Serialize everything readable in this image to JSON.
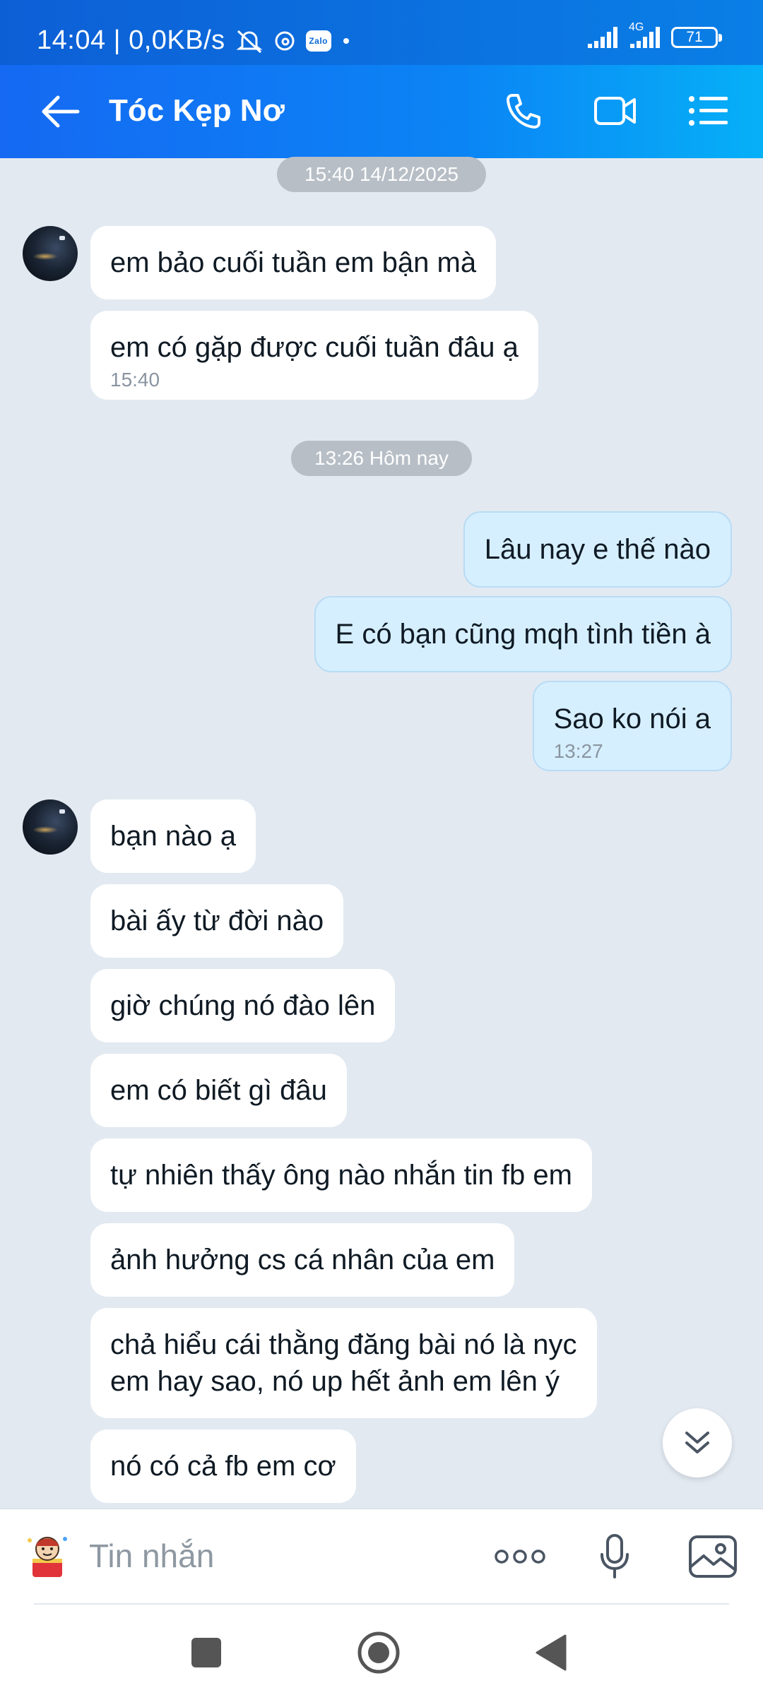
{
  "status_bar": {
    "time_and_speed": "14:04 | 0,0KB/s",
    "network_label": "4G",
    "battery": "71"
  },
  "header": {
    "title": "Tóc Kẹp Nơ"
  },
  "date_separators": [
    "15:40 14/12/2025",
    "13:26 Hôm nay"
  ],
  "messages": [
    {
      "text": "em bảo cuối tuần em bận mà"
    },
    {
      "text": "em có gặp được cuối tuần đâu ạ",
      "time": "15:40"
    },
    {
      "text": "Lâu nay e thế nào"
    },
    {
      "text": "E có bạn cũng mqh tình tiền à"
    },
    {
      "text": "Sao ko nói a",
      "time": "13:27"
    },
    {
      "text": "bạn nào ạ"
    },
    {
      "text": "bài ấy từ đời nào"
    },
    {
      "text": "giờ chúng nó đào lên"
    },
    {
      "text": "em có biết gì đâu"
    },
    {
      "text": "tự nhiên thấy ông nào nhắn tin fb em"
    },
    {
      "text": "ảnh hưởng cs cá nhân của em"
    },
    {
      "text": "chả hiểu cái thằng đăng bài nó là nyc"
    },
    {
      "text": "em hay sao, nó up hết ảnh em lên ý"
    },
    {
      "text": "nó có cả fb em cơ"
    }
  ],
  "input_bar": {
    "placeholder": "Tin nhắn"
  },
  "colors": {
    "header_gradient_start": "#1569f2",
    "header_gradient_end": "#06b0f7",
    "sent_bubble": "#d6efff",
    "received_bubble": "#ffffff",
    "chat_background": "#e2e9f1"
  }
}
